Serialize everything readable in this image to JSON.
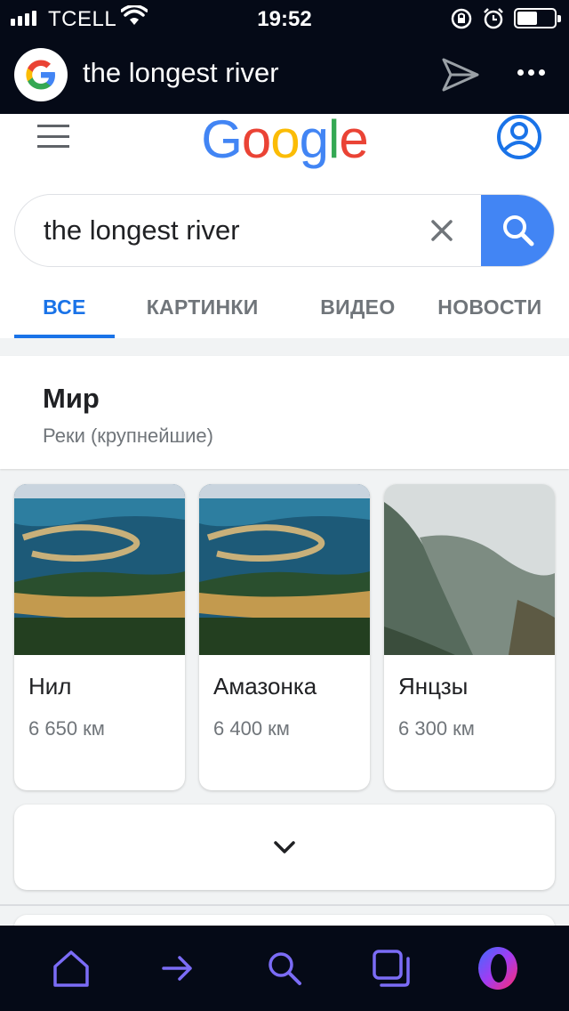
{
  "status_bar": {
    "carrier": "TCELL",
    "time": "19:52"
  },
  "browser": {
    "address_text": "the longest river",
    "icons": [
      "google-g-icon",
      "send-icon",
      "more-icon"
    ]
  },
  "google": {
    "logo_letters": [
      {
        "ch": "G",
        "color": "#4285f4"
      },
      {
        "ch": "o",
        "color": "#ea4335"
      },
      {
        "ch": "o",
        "color": "#fbbc05"
      },
      {
        "ch": "g",
        "color": "#4285f4"
      },
      {
        "ch": "l",
        "color": "#34a853"
      },
      {
        "ch": "e",
        "color": "#ea4335"
      }
    ],
    "search": {
      "value": "the longest river",
      "placeholder": ""
    },
    "tabs": [
      {
        "label": "ВСЕ",
        "active": true
      },
      {
        "label": "КАРТИНКИ",
        "active": false
      },
      {
        "label": "ВИДЕО",
        "active": false
      },
      {
        "label": "НОВОСТИ",
        "active": false
      }
    ],
    "header_card": {
      "title": "Мир",
      "subtitle": "Реки (крупнейшие)"
    },
    "rivers": [
      {
        "name": "Нил",
        "length": "6 650 км"
      },
      {
        "name": "Амазонка",
        "length": "6 400 км"
      },
      {
        "name": "Янцзы",
        "length": "6 300 км"
      }
    ]
  },
  "colors": {
    "accent": "#1a73e8",
    "search_button": "#4285f4",
    "chrome_bg": "#050a17",
    "nav_icon": "#7b6cf6"
  },
  "bottom_nav": [
    "home-icon",
    "forward-icon",
    "search-icon",
    "tabs-icon",
    "opera-icon"
  ]
}
